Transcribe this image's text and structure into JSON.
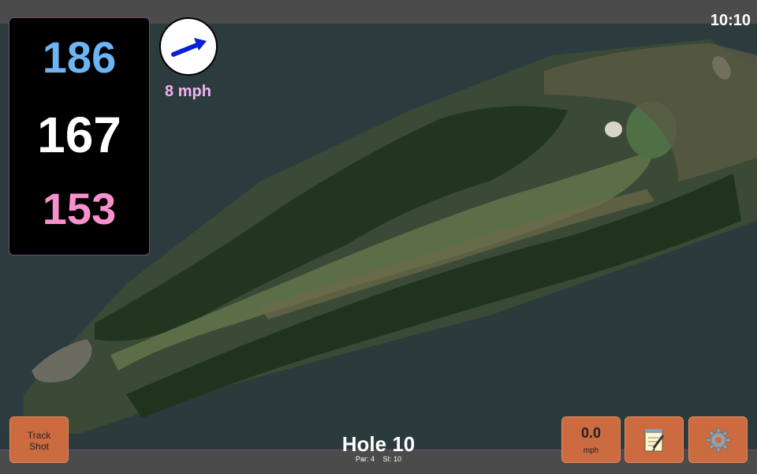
{
  "status": {
    "time": "10:10"
  },
  "distances": {
    "back": "186",
    "middle": "167",
    "front": "153"
  },
  "wind": {
    "speed_label": "8 mph",
    "direction_icon": "wind-arrow-icon"
  },
  "hole": {
    "title": "Hole 10",
    "par": "Par: 4",
    "stroke_index": "SI: 10"
  },
  "buttons": {
    "track_line1": "Track",
    "track_line2": "Shot",
    "speed_value": "0.0",
    "speed_unit": "mph",
    "notes_icon": "notepad-icon",
    "settings_icon": "gear-icon"
  },
  "colors": {
    "back_distance": "#6cb4f3",
    "middle_distance": "#ffffff",
    "front_distance": "#f890cc",
    "button": "#cd6b40",
    "wind_label": "#f3b3f1"
  }
}
